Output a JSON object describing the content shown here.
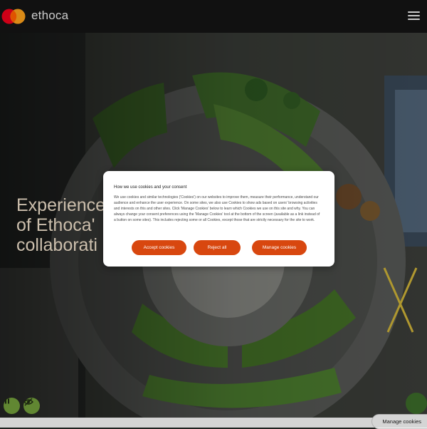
{
  "header": {
    "brand": "ethoca",
    "logo_colors": {
      "left": "#eb001b",
      "right": "#f79e1b",
      "overlap": "#ff5f00"
    },
    "menu_icon": "hamburger-menu-icon"
  },
  "hero": {
    "title_lines": [
      "Experience",
      "of Ethoca'",
      "collaborati"
    ],
    "controls": {
      "pause_icon": "pause-icon",
      "visibility_icon": "eye-slash-icon"
    },
    "control_color": "#6f9a3a"
  },
  "cookie_dialog": {
    "title": "How we use cookies and your consent",
    "body": "We use cookies and similar technologies ('Cookies') on our websites to improve them, measure their performance, understand our audience and enhance the user experience. On some sites, we also use Cookies to show ads based on users' browsing activities and interests on this and other sites. Click 'Manage Cookies' below to learn which Cookies we use on this site and why. You can always change your consent preferences using the 'Manage Cookies' tool at the bottom of the screen (available as a link instead of a button on some sites). This includes rejecting some or all Cookies, except those that are strictly necessary for the site to work.",
    "buttons": {
      "accept": "Accept cookies",
      "reject": "Reject all",
      "manage": "Manage cookies"
    },
    "button_color": "#d8470f"
  },
  "footer": {
    "manage_tab": "Manage cookies"
  }
}
